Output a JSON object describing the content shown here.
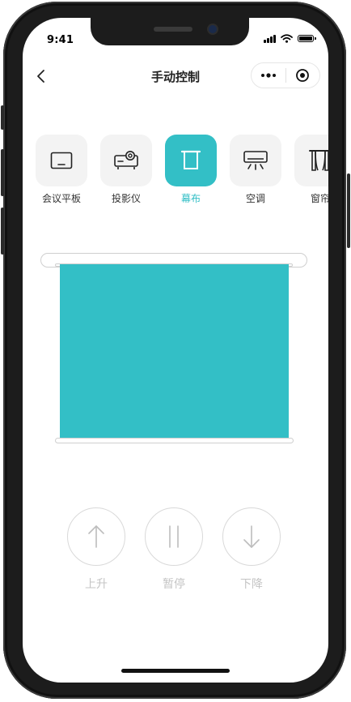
{
  "status": {
    "time": "9:41"
  },
  "navbar": {
    "title": "手动控制"
  },
  "devices": [
    {
      "label": "会议平板",
      "icon": "tablet-icon",
      "active": false
    },
    {
      "label": "投影仪",
      "icon": "projector-icon",
      "active": false
    },
    {
      "label": "幕布",
      "icon": "projection-screen-icon",
      "active": true
    },
    {
      "label": "空调",
      "icon": "air-conditioner-icon",
      "active": false
    },
    {
      "label": "窗帘",
      "icon": "curtain-icon",
      "active": false
    }
  ],
  "controls": {
    "up_label": "上升",
    "pause_label": "暂停",
    "down_label": "下降"
  },
  "colors": {
    "accent": "#33bfc6",
    "inactive_tile": "#f3f3f3",
    "control_label": "#c4c4c4"
  }
}
